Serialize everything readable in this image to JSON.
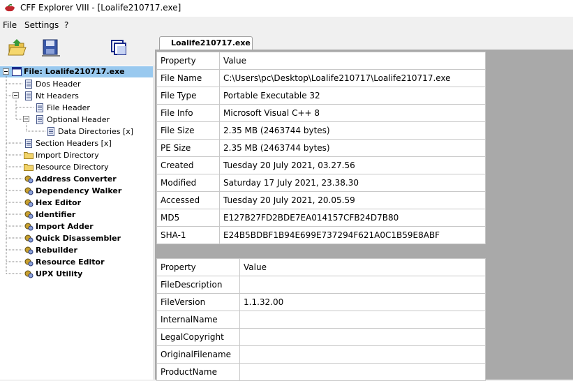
{
  "window": {
    "title": "CFF Explorer VIII - [Loalife210717.exe]"
  },
  "menu": {
    "items": [
      "File",
      "Settings",
      "?"
    ]
  },
  "toolbar": {
    "buttons": [
      "open-folder-icon",
      "save-disk-icon",
      "windows-icon"
    ]
  },
  "tree": {
    "items": [
      {
        "label": "File: Loalife210717.exe",
        "icon": "file-window-icon",
        "bold": true,
        "selected": true
      },
      {
        "label": "Dos Header",
        "icon": "struct-icon"
      },
      {
        "label": "Nt Headers",
        "icon": "struct-icon"
      },
      {
        "label": "File Header",
        "icon": "struct-icon"
      },
      {
        "label": "Optional Header",
        "icon": "struct-icon"
      },
      {
        "label": "Data Directories [x]",
        "icon": "struct-icon"
      },
      {
        "label": "Section Headers [x]",
        "icon": "struct-icon"
      },
      {
        "label": "Import Directory",
        "icon": "folder-icon"
      },
      {
        "label": "Resource Directory",
        "icon": "folder-icon"
      },
      {
        "label": "Address Converter",
        "icon": "gear-icon",
        "bold": true
      },
      {
        "label": "Dependency Walker",
        "icon": "gear-icon",
        "bold": true
      },
      {
        "label": "Hex Editor",
        "icon": "gear-icon",
        "bold": true
      },
      {
        "label": "Identifier",
        "icon": "gear-icon",
        "bold": true
      },
      {
        "label": "Import Adder",
        "icon": "gear-icon",
        "bold": true
      },
      {
        "label": "Quick Disassembler",
        "icon": "gear-icon",
        "bold": true
      },
      {
        "label": "Rebuilder",
        "icon": "gear-icon",
        "bold": true
      },
      {
        "label": "Resource Editor",
        "icon": "gear-icon",
        "bold": true
      },
      {
        "label": "UPX Utility",
        "icon": "gear-icon",
        "bold": true
      }
    ]
  },
  "tab": {
    "label": "Loalife210717.exe"
  },
  "file_info": {
    "headers": [
      "Property",
      "Value"
    ],
    "rows": [
      [
        "File Name",
        "C:\\Users\\pc\\Desktop\\Loalife210717\\Loalife210717.exe"
      ],
      [
        "File Type",
        "Portable Executable 32"
      ],
      [
        "File Info",
        "Microsoft Visual C++ 8"
      ],
      [
        "File Size",
        "2.35 MB (2463744 bytes)"
      ],
      [
        "PE Size",
        "2.35 MB (2463744 bytes)"
      ],
      [
        "Created",
        "Tuesday 20 July 2021, 03.27.56"
      ],
      [
        "Modified",
        "Saturday 17 July 2021, 23.38.30"
      ],
      [
        "Accessed",
        "Tuesday 20 July 2021, 20.05.59"
      ],
      [
        "MD5",
        "E127B27FD2BDE7EA014157CFB24D7B80"
      ],
      [
        "SHA-1",
        "E24B5BDBF1B94E699E737294F621A0C1B59E8ABF"
      ]
    ]
  },
  "version_info": {
    "headers": [
      "Property",
      "Value"
    ],
    "rows": [
      [
        "FileDescription",
        ""
      ],
      [
        "FileVersion",
        "1.1.32.00"
      ],
      [
        "InternalName",
        ""
      ],
      [
        "LegalCopyright",
        ""
      ],
      [
        "OriginalFilename",
        ""
      ],
      [
        "ProductName",
        ""
      ]
    ]
  },
  "colors": {
    "selection": "#99c9ef",
    "panel_bg": "#a9a9a9",
    "chrome": "#f0f0f0"
  }
}
